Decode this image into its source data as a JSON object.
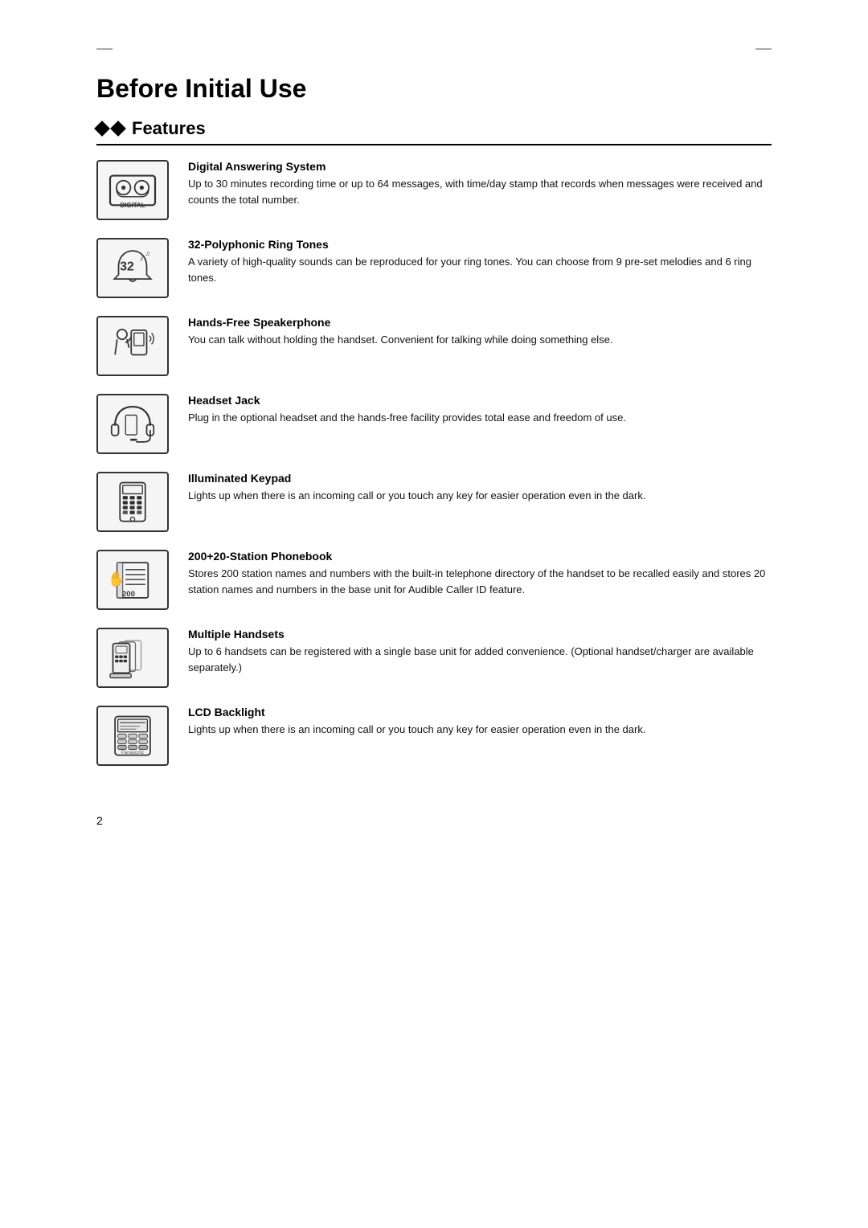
{
  "page": {
    "title": "Before Initial Use",
    "section": "Features",
    "page_number": "2"
  },
  "features": [
    {
      "id": "digital-answering",
      "title": "Digital Answering System",
      "description": "Up to 30 minutes recording time or up to 64 messages, with time/day stamp that records when messages were received and counts the total number.",
      "icon_type": "digital"
    },
    {
      "id": "polyphonic-ring",
      "title": "32-Polyphonic Ring Tones",
      "description": "A variety of high-quality sounds can be reproduced for your ring tones. You can choose from 9 pre-set melodies and 6 ring tones.",
      "icon_type": "bell"
    },
    {
      "id": "handsfree-speakerphone",
      "title": "Hands-Free Speakerphone",
      "description": "You can talk without holding the handset. Convenient for talking while doing something else.",
      "icon_type": "speakerphone"
    },
    {
      "id": "headset-jack",
      "title": "Headset Jack",
      "description": "Plug in the optional headset and the hands-free facility provides total ease and freedom of use.",
      "icon_type": "headset"
    },
    {
      "id": "illuminated-keypad",
      "title": "Illuminated Keypad",
      "description": "Lights up when there is an incoming call or you touch any key for easier operation even in the dark.",
      "icon_type": "keypad"
    },
    {
      "id": "station-phonebook",
      "title": "200+20-Station Phonebook",
      "description": "Stores 200 station names and numbers with the built-in telephone directory of the handset to be recalled easily and stores 20 station names and numbers in the base unit for Audible Caller ID feature.",
      "icon_type": "phonebook"
    },
    {
      "id": "multiple-handsets",
      "title": "Multiple Handsets",
      "description": "Up to 6 handsets can be registered with a single base unit for added convenience. (Optional handset/charger are available separately.)",
      "icon_type": "handsets"
    },
    {
      "id": "lcd-backlight",
      "title": "LCD Backlight",
      "description": "Lights up when there is an incoming call or you touch any key for easier operation even in the dark.",
      "icon_type": "lcd"
    }
  ]
}
